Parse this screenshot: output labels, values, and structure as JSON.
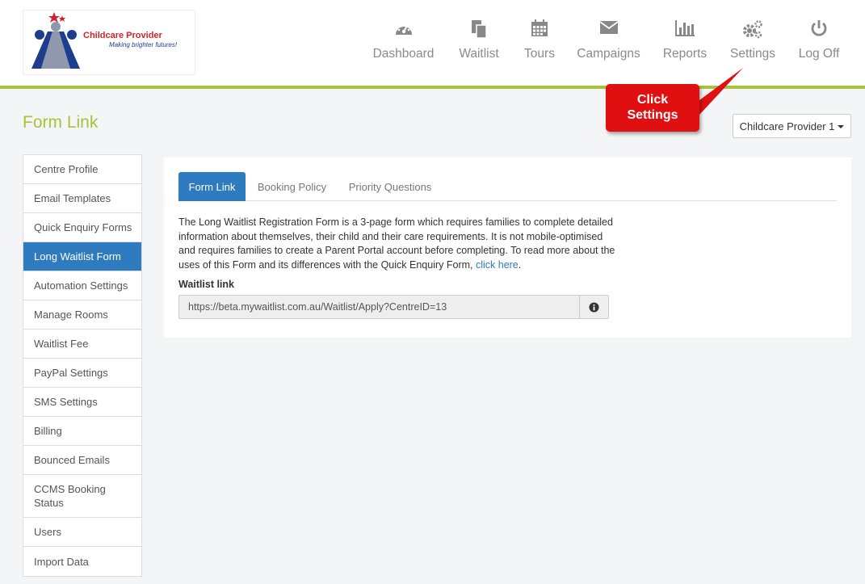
{
  "brand": {
    "name": "Childcare Provider",
    "tagline": "Making brighter futures!"
  },
  "nav": [
    {
      "label": "Dashboard",
      "icon": "dashboard-icon"
    },
    {
      "label": "Waitlist",
      "icon": "copy-icon"
    },
    {
      "label": "Tours",
      "icon": "calendar-icon"
    },
    {
      "label": "Campaigns",
      "icon": "envelope-icon"
    },
    {
      "label": "Reports",
      "icon": "bar-chart-icon"
    },
    {
      "label": "Settings",
      "icon": "gears-icon"
    },
    {
      "label": "Log Off",
      "icon": "power-icon"
    }
  ],
  "callout": {
    "line1": "Click",
    "line2": "Settings"
  },
  "page": {
    "title": "Form Link"
  },
  "provider_select": {
    "label": "Childcare Provider 1"
  },
  "sidebar": {
    "items": [
      {
        "label": "Centre Profile"
      },
      {
        "label": "Email Templates"
      },
      {
        "label": "Quick Enquiry Forms"
      },
      {
        "label": "Long Waitlist Form"
      },
      {
        "label": "Automation Settings"
      },
      {
        "label": "Manage Rooms"
      },
      {
        "label": "Waitlist Fee"
      },
      {
        "label": "PayPal Settings"
      },
      {
        "label": "SMS Settings"
      },
      {
        "label": "Billing"
      },
      {
        "label": "Bounced Emails"
      },
      {
        "label": "CCMS Booking Status"
      },
      {
        "label": "Users"
      },
      {
        "label": "Import Data"
      }
    ],
    "active": "Long Waitlist Form"
  },
  "tabs": [
    {
      "label": "Form Link"
    },
    {
      "label": "Booking Policy"
    },
    {
      "label": "Priority Questions"
    }
  ],
  "content": {
    "description": "The Long Waitlist Registration Form is a 3-page form which requires families to complete detailed information about themselves, their child and their care requirements. It is not mobile-optimised and requires families to create a Parent Portal account before completing. To read more about the uses of this Form and its differences with the Quick Enquiry Form, ",
    "link_text": "click here",
    "link_suffix": ".",
    "waitlist_link_label": "Waitlist link",
    "waitlist_link_value": "https://beta.mywaitlist.com.au/Waitlist/Apply?CentreID=13"
  },
  "colors": {
    "accent_green": "#a6c43a",
    "active_blue": "#2e7bbf",
    "callout_red": "#e01010"
  }
}
